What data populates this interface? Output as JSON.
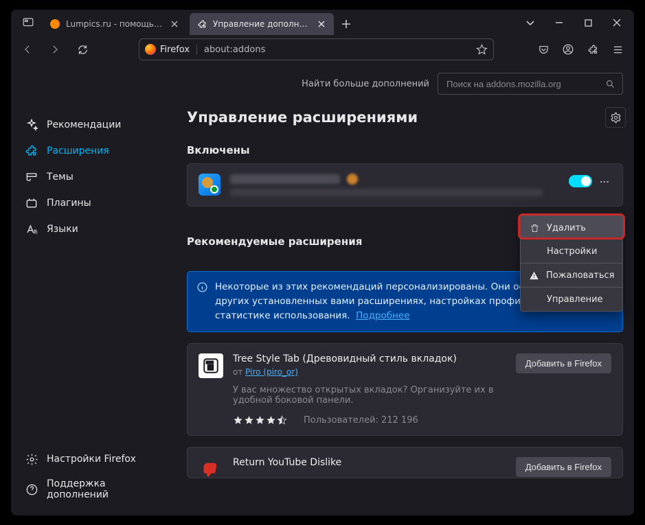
{
  "tabs": [
    {
      "label": "Lumpics.ru - помощь с компь",
      "favicon_color": "#ff8a00"
    },
    {
      "label": "Управление дополнениями"
    }
  ],
  "url": {
    "brand": "Firefox",
    "address": "about:addons"
  },
  "sidebar": {
    "items": [
      {
        "label": "Рекомендации"
      },
      {
        "label": "Расширения"
      },
      {
        "label": "Темы"
      },
      {
        "label": "Плагины"
      },
      {
        "label": "Языки"
      }
    ],
    "footer": [
      {
        "label": "Настройки Firefox"
      },
      {
        "label": "Поддержка дополнений"
      }
    ]
  },
  "search": {
    "label": "Найти больше дополнений",
    "placeholder": "Поиск на addons.mozilla.org"
  },
  "page_title": "Управление расширениями",
  "section_enabled": "Включены",
  "section_recommended": "Рекомендуемые расширения",
  "menu": {
    "remove": "Удалить",
    "settings": "Настройки",
    "report": "Пожаловаться",
    "manage": "Управление"
  },
  "notice": {
    "text": "Некоторые из этих рекомендаций персонализированы. Они основаны на других установленных вами расширениях, настройках профиля и статистике использования.",
    "link": "Подробнее"
  },
  "rec1": {
    "title": "Tree Style Tab (Древовидный стиль вкладок)",
    "by": "от ",
    "author": "Piro (piro_or)",
    "desc": "У вас множество открытых вкладок? Организуйте их в удобной боковой панели.",
    "users_label": "Пользователей: ",
    "users": "212 196",
    "button": "Добавить в Firefox"
  },
  "rec2": {
    "title": "Return YouTube Dislike",
    "button": "Добавить в Firefox"
  }
}
